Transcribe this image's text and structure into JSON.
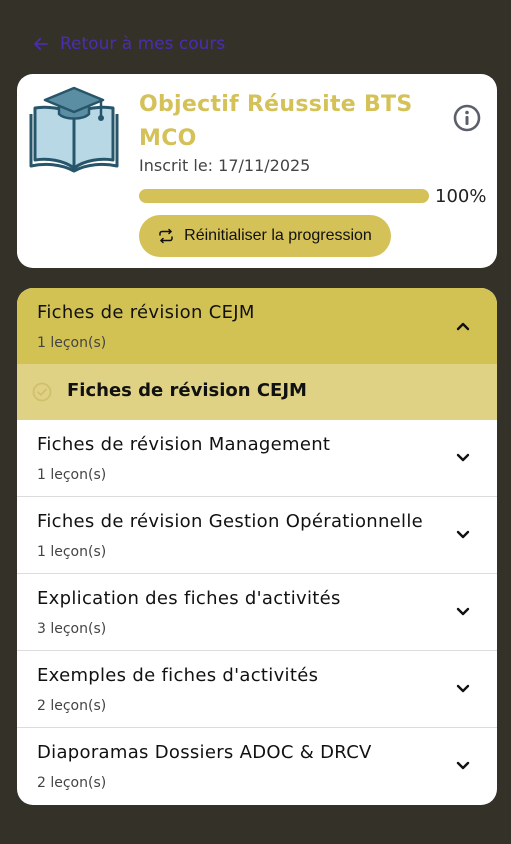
{
  "nav": {
    "back_label": "Retour à mes cours"
  },
  "course": {
    "title": "Objectif Réussite BTS MCO",
    "enrolled": "Inscrit le: 17/11/2025",
    "progress_percent": 100,
    "progress_label": "100%",
    "reset_label": "Réinitialiser la progression"
  },
  "sections": [
    {
      "name": "Fiches de révision CEJM",
      "count": "1 leçon(s)",
      "expanded": true,
      "lessons": [
        {
          "name": "Fiches de révision CEJM",
          "completed": true
        }
      ]
    },
    {
      "name": "Fiches de révision Management",
      "count": "1 leçon(s)"
    },
    {
      "name": "Fiches de révision Gestion Opérationnelle",
      "count": "1 leçon(s)"
    },
    {
      "name": "Explication des fiches d'activités",
      "count": "3 leçon(s)"
    },
    {
      "name": "Exemples de fiches d'activités",
      "count": "2 leçon(s)"
    },
    {
      "name": "Diaporamas Dossiers ADOC & DRCV",
      "count": "2 leçon(s)"
    }
  ],
  "colors": {
    "accent": "#d4c157",
    "background": "#343128",
    "back_link": "#4b2db0"
  },
  "icons": {
    "course": "graduation-book-icon",
    "info": "info-icon",
    "reset": "repeat-icon",
    "back": "arrow-left-icon"
  }
}
